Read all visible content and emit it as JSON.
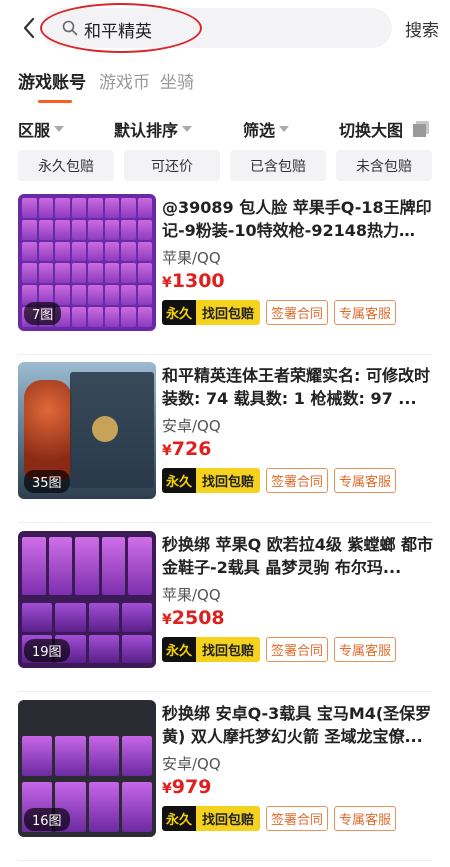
{
  "header": {
    "search_query": "和平精英",
    "search_button": "搜索"
  },
  "tabs": [
    "游戏账号",
    "游戏币",
    "坐骑"
  ],
  "filters": {
    "region": "区服",
    "sort": "默认排序",
    "filter": "筛选",
    "view_toggle": "切换大图"
  },
  "chips": [
    "永久包赔",
    "可还价",
    "已含包赔",
    "未含包赔"
  ],
  "listings": [
    {
      "title": "@39089 包人脸 苹果手Q-18王牌印记-9粉装-10特效枪-92148热力值-...",
      "platform": "苹果/QQ",
      "currency": "¥",
      "price": "1300",
      "image_count": "7图",
      "badge_permanent": "永久",
      "badge_compensation": "找回包赔",
      "badge_contract": "签署合同",
      "badge_service": "专属客服"
    },
    {
      "title": "和平精英连体王者荣耀实名: 可修改时装数: 74 载具数: 1 枪械数: 97 ...",
      "platform": "安卓/QQ",
      "currency": "¥",
      "price": "726",
      "image_count": "35图",
      "badge_permanent": "永久",
      "badge_compensation": "找回包赔",
      "badge_contract": "签署合同",
      "badge_service": "专属客服"
    },
    {
      "title": "秒换绑 苹果Q 欧若拉4级 紫螳螂 都市 金鞋子-2载具 晶梦灵驹 布尔玛...",
      "platform": "苹果/QQ",
      "currency": "¥",
      "price": "2508",
      "image_count": "19图",
      "badge_permanent": "永久",
      "badge_compensation": "找回包赔",
      "badge_contract": "签署合同",
      "badge_service": "专属客服"
    },
    {
      "title": "秒换绑 安卓Q-3载具 宝马M4(圣保罗黄) 双人摩托梦幻火箭 圣域龙宝僚...",
      "platform": "安卓/QQ",
      "currency": "¥",
      "price": "979",
      "image_count": "16图",
      "badge_permanent": "永久",
      "badge_compensation": "找回包赔",
      "badge_contract": "签署合同",
      "badge_service": "专属客服"
    }
  ],
  "colors": {
    "accent": "#ff5a1f",
    "price": "#e0201e",
    "badge_yellow": "#f5d21e",
    "badge_outline": "#e8925b",
    "annotation_circle": "#d9262a"
  }
}
